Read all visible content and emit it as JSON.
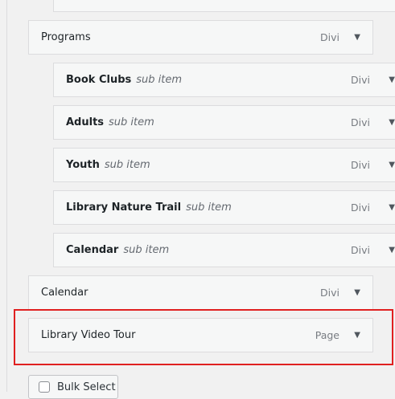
{
  "menu": {
    "items": [
      {
        "title": "Programs",
        "sub_label": "",
        "type": "Divi",
        "level": 0
      },
      {
        "title": "Book Clubs",
        "sub_label": "sub item",
        "type": "Divi",
        "level": 1
      },
      {
        "title": "Adults",
        "sub_label": "sub item",
        "type": "Divi",
        "level": 1
      },
      {
        "title": "Youth",
        "sub_label": "sub item",
        "type": "Divi",
        "level": 1
      },
      {
        "title": "Library Nature Trail",
        "sub_label": "sub item",
        "type": "Divi",
        "level": 1
      },
      {
        "title": "Calendar",
        "sub_label": "sub item",
        "type": "Divi",
        "level": 1
      },
      {
        "title": "Calendar",
        "sub_label": "",
        "type": "Divi",
        "level": 0
      },
      {
        "title": "Library Video Tour",
        "sub_label": "",
        "type": "Page",
        "level": 0
      }
    ],
    "arrow_icon": "triangle-down-icon"
  },
  "bulk_select": {
    "label": "Bulk Select",
    "checked": false
  },
  "highlight_color": "#e02020"
}
